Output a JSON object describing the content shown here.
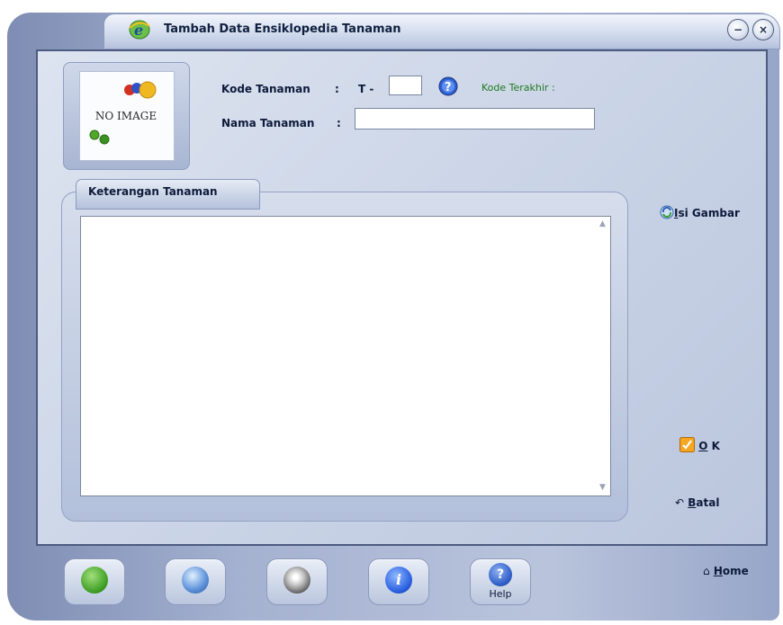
{
  "window": {
    "title": "Tambah Data Ensiklopedia Tanaman",
    "minimize_glyph": "−",
    "close_glyph": "×"
  },
  "image_box": {
    "placeholder_text": "NO IMAGE"
  },
  "form": {
    "kode_label": "Kode Tanaman",
    "kode_sep": ":",
    "kode_prefix": "T -",
    "kode_value": "",
    "last_code_label": "Kode Terakhir :",
    "nama_label": "Nama Tanaman",
    "nama_sep": ":",
    "nama_value": ""
  },
  "description": {
    "tab_label": "Keterangan Tanaman",
    "value": ""
  },
  "actions": {
    "isi_gambar": {
      "accel": "I",
      "rest": "si Gambar"
    },
    "ok": {
      "accel": "O",
      "rest": " K"
    },
    "batal": {
      "accel": "B",
      "rest": "atal"
    },
    "home": {
      "accel": "H",
      "rest": "ome"
    }
  },
  "toolbar": {
    "help_label": "Help"
  },
  "icons": {
    "app": "ie-logo-icon",
    "help_small": "question-icon",
    "isi_gambar": "refresh-image-icon",
    "ok": "checkmark-icon",
    "batal": "undo-arrow-icon",
    "home": "home-icon",
    "tool1": "recycle-icon",
    "tool2": "globe-icon",
    "tool3": "disc-icon",
    "tool4": "info-icon",
    "tool5": "help-icon"
  },
  "colors": {
    "frame": "#a4b1d0",
    "panel": "#c9d3e6",
    "accent_green": "#1e7a1e",
    "text_dark": "#0d1a3a"
  }
}
